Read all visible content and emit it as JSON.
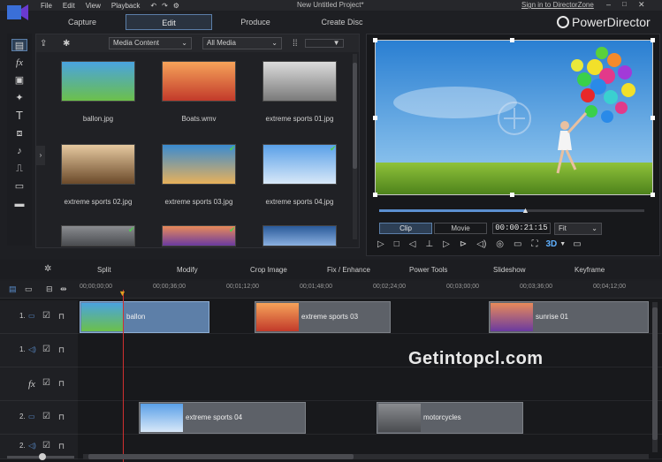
{
  "menu": [
    "File",
    "Edit",
    "View",
    "Playback"
  ],
  "window_title": "New Untitled Project*",
  "signin_link": "Sign in to DirectorZone",
  "brand": "PowerDirector",
  "tabs": [
    {
      "label": "Capture",
      "active": false
    },
    {
      "label": "Edit",
      "active": true
    },
    {
      "label": "Produce",
      "active": false
    },
    {
      "label": "Create Disc",
      "active": false
    }
  ],
  "library": {
    "filter1": "Media Content",
    "filter2": "All Media",
    "items": [
      {
        "label": "ballon.jpg",
        "colors": [
          "#4aa3e0",
          "#6cc04a"
        ],
        "checked": false
      },
      {
        "label": "Boats.wmv",
        "colors": [
          "#f6a35a",
          "#c23a2a"
        ],
        "checked": false
      },
      {
        "label": "extreme sports 01.jpg",
        "colors": [
          "#dcdcdc",
          "#7a7a7a"
        ],
        "checked": false
      },
      {
        "label": "extreme sports 02.jpg",
        "colors": [
          "#e6c9a0",
          "#6b4a2a"
        ],
        "checked": false
      },
      {
        "label": "extreme sports 03.jpg",
        "colors": [
          "#3a8bd0",
          "#e8b15a"
        ],
        "checked": true
      },
      {
        "label": "extreme sports 04.jpg",
        "colors": [
          "#5aa0e8",
          "#d8e8f8"
        ],
        "checked": true
      },
      {
        "label": "",
        "colors": [
          "#8a8c90",
          "#4a4c50"
        ],
        "checked": true
      },
      {
        "label": "",
        "colors": [
          "#e88a5a",
          "#6a3aa0"
        ],
        "checked": true
      },
      {
        "label": "",
        "colors": [
          "#2a5a9a",
          "#8ab0e0"
        ],
        "checked": false
      }
    ]
  },
  "preview": {
    "clip_tab": "Clip",
    "movie_tab": "Movie",
    "timecode": "00:00:21:15",
    "fit": "Fit",
    "mode_3d": "3D",
    "progress": 0.55
  },
  "edit_tools": [
    "Split",
    "Modify",
    "Crop Image",
    "Fix / Enhance",
    "Power Tools",
    "Slideshow",
    "Keyframe"
  ],
  "ruler": [
    "00;00;00;00",
    "00;00;36;00",
    "00;01;12;00",
    "00;01;48;00",
    "00;02;24;00",
    "00;03;00;00",
    "00;03;36;00",
    "00;04;12;00"
  ],
  "tracks": [
    {
      "label": "1.",
      "kind": "video"
    },
    {
      "label": "1.",
      "kind": "audio"
    },
    {
      "label": "fx",
      "kind": "fx"
    },
    {
      "label": "2.",
      "kind": "video"
    },
    {
      "label": "2.",
      "kind": "audio"
    }
  ],
  "clips": [
    {
      "label": "ballon",
      "track": 0,
      "selected": true,
      "colors": [
        "#4aa3e0",
        "#6cc04a"
      ]
    },
    {
      "label": "extreme sports 03",
      "track": 0,
      "selected": false,
      "colors": [
        "#f6a35a",
        "#c23a2a"
      ]
    },
    {
      "label": "sunrise 01",
      "track": 0,
      "selected": false,
      "colors": [
        "#e88a5a",
        "#6a3aa0"
      ]
    },
    {
      "label": "extreme sports 04",
      "track": 3,
      "selected": false,
      "colors": [
        "#5aa0e8",
        "#d8e8f8"
      ]
    },
    {
      "label": "motorcycles",
      "track": 3,
      "selected": false,
      "colors": [
        "#8a8c90",
        "#4a4c50"
      ]
    }
  ],
  "watermark": "Getintopcl.com"
}
